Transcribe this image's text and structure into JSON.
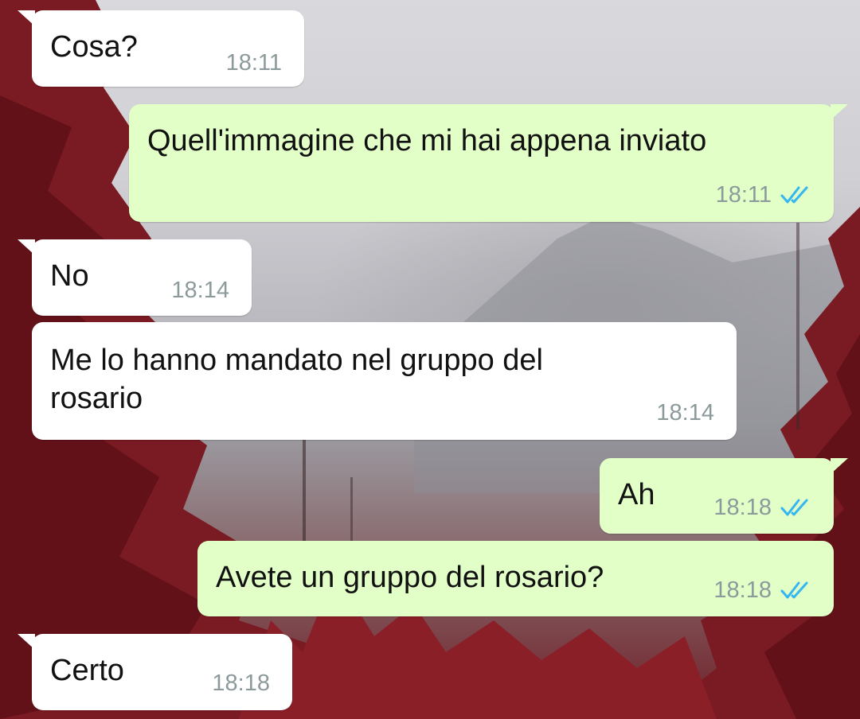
{
  "colors": {
    "incoming_bubble": "#ffffff",
    "outgoing_bubble": "#e2ffc8",
    "message_text": "#111111",
    "timestamp": "#8c9a9c",
    "read_ticks": "#34b7f1"
  },
  "messages": [
    {
      "direction": "incoming",
      "text": "Cosa?",
      "time": "18:11"
    },
    {
      "direction": "outgoing",
      "text": "Quell'immagine che mi hai appena inviato",
      "time": "18:11",
      "status_icon": "double-check-icon"
    },
    {
      "direction": "incoming",
      "text": "No",
      "time": "18:14"
    },
    {
      "direction": "incoming",
      "text": "Me lo hanno mandato nel gruppo del\nrosario",
      "time": "18:14"
    },
    {
      "direction": "outgoing",
      "text": "Ah",
      "time": "18:18",
      "status_icon": "double-check-icon"
    },
    {
      "direction": "outgoing",
      "text": "Avete un gruppo del rosario?",
      "time": "18:18",
      "status_icon": "double-check-icon"
    },
    {
      "direction": "incoming",
      "text": "Certo",
      "time": "18:18"
    }
  ]
}
